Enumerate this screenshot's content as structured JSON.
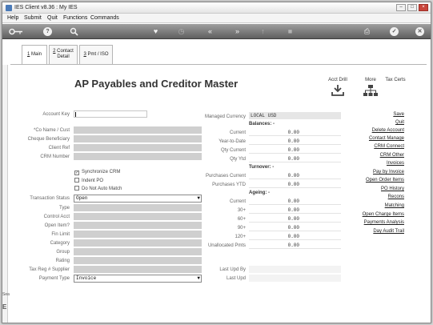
{
  "window": {
    "title": "IES Client v8.36 : My IES",
    "controls": [
      "–",
      "□",
      "×"
    ]
  },
  "menu": [
    "Help",
    "Submit",
    "Quit",
    "Functions",
    "Commands"
  ],
  "toolbar": {
    "icons": [
      "key-icon",
      "help-icon",
      "search-icon",
      "heart-icon",
      "history-icon",
      "rewind-icon",
      "fast-forward-icon",
      "upload-icon",
      "stop-icon",
      "print-icon",
      "check-icon",
      "close-icon"
    ]
  },
  "tabs": [
    {
      "num": "1",
      "label": "Main"
    },
    {
      "num": "2",
      "label": "Contact Detail"
    },
    {
      "num": "3",
      "label": "Pmt / ISO"
    }
  ],
  "page": {
    "title": "AP Payables and Creditor Master"
  },
  "header_actions": {
    "acct_drill": "Acct Drill",
    "more": "More",
    "tax_certs": "Tax Certs"
  },
  "left_fields": {
    "account_key": "Account Key",
    "co_name": "*Co Name / Cust",
    "cheque_beneficiary": "Cheque Beneficiary",
    "client_ref": "Client Ref",
    "crm_number": "CRM Number"
  },
  "checks": {
    "sync_crm": "Synchronize CRM",
    "indent_po": "Indent PO",
    "no_auto_match": "Do Not Auto Match"
  },
  "transaction_status": {
    "label": "Transaction Status",
    "value": "Open"
  },
  "lower_fields": {
    "type": "Type",
    "control_acct": "Control Acct",
    "open_item": "Open Item?",
    "fin_limit": "Fin Limit",
    "category": "Category",
    "group": "Group",
    "rating": "Rating",
    "tax_reg": "Tax Reg # Supplier"
  },
  "payment_type": {
    "label": "Payment Type",
    "value": "Invoice"
  },
  "managed_currency": {
    "label": "Managed Currency",
    "value": "LOCAL USD"
  },
  "balances": {
    "heading": "Balances: -",
    "rows": [
      {
        "label": "Current",
        "value": "0.00"
      },
      {
        "label": "Year-to-Date",
        "value": "0.00"
      },
      {
        "label": "Qty Current",
        "value": "0.00"
      },
      {
        "label": "Qty Ytd",
        "value": "0.00"
      }
    ]
  },
  "turnover": {
    "heading": "Turnover: -",
    "rows": [
      {
        "label": "Purchases Current",
        "value": "0.00"
      },
      {
        "label": "Purchases YTD",
        "value": "0.00"
      }
    ]
  },
  "ageing": {
    "heading": "Ageing: -",
    "rows": [
      {
        "label": "Current",
        "value": "0.00"
      },
      {
        "label": "30+",
        "value": "0.00"
      },
      {
        "label": "60+",
        "value": "0.00"
      },
      {
        "label": "90+",
        "value": "0.00"
      },
      {
        "label": "120+",
        "value": "0.00"
      },
      {
        "label": "Unallocated Pmts",
        "value": "0.00"
      }
    ]
  },
  "last_upd": {
    "by": "Last Upd By",
    "date": "Last Upd"
  },
  "links": [
    "Save",
    "Quit",
    "Delete Account",
    "Contact Manage",
    "CRM Connect",
    "CRM Other",
    "Invoices",
    "Pay by Invoice",
    "Open Order Items",
    "PO History",
    "Recons",
    "Matching",
    "Open Charge Items",
    "Payments Analysis",
    "Day Audit Trail"
  ],
  "left_strip": {
    "text_top": "Sea",
    "text_bottom": "E"
  }
}
